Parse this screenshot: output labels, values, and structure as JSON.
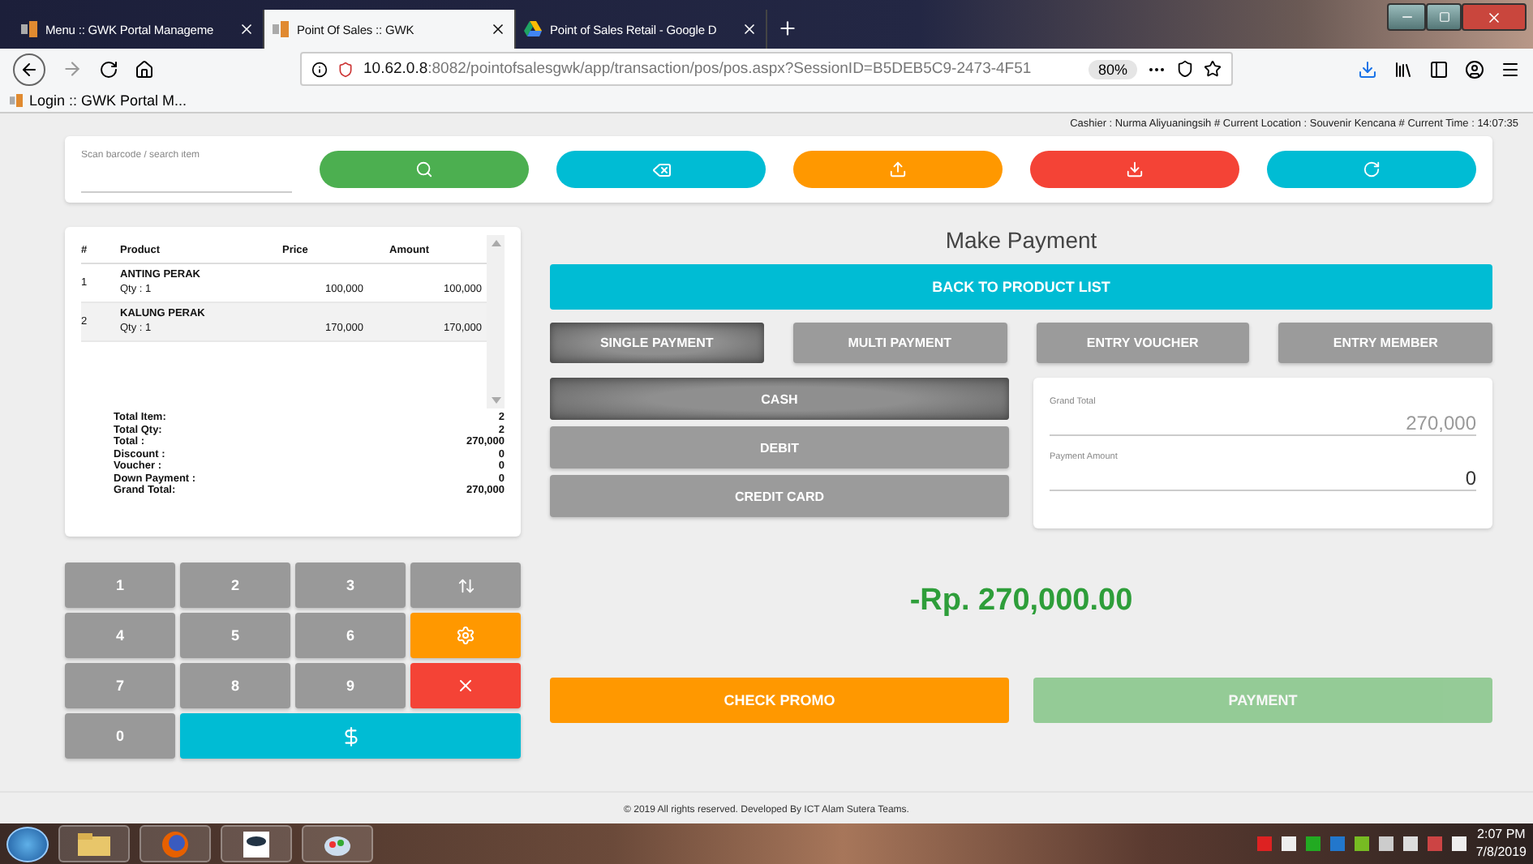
{
  "browser": {
    "tabs": [
      {
        "title": "Menu :: GWK Portal Manageme",
        "selected": false
      },
      {
        "title": "Point Of Sales :: GWK",
        "selected": true
      },
      {
        "title": "Point of Sales Retail - Google D",
        "selected": false
      }
    ],
    "url_host": "10.62.0.8",
    "url_rest": ":8082/pointofsalesgwk/app/transaction/pos/pos.aspx?SessionID=B5DEB5C9-2473-4F51",
    "zoom": "80%",
    "bookmarks": [
      "Login :: GWK Portal M..."
    ]
  },
  "status_line": "Cashier : Nurma Aliyuaningsih # Current Location : Souvenir Kencana # Current Time : 14:07:35",
  "search": {
    "placeholder": "Scan barcode / search item"
  },
  "cart": {
    "columns": [
      "#",
      "Product",
      "Price",
      "Amount"
    ],
    "items": [
      {
        "no": "1",
        "product": "ANTING PERAK",
        "qty": "Qty : 1",
        "price": "100,000",
        "amount": "100,000",
        "selected": false
      },
      {
        "no": "2",
        "product": "KALUNG PERAK",
        "qty": "Qty : 1",
        "price": "170,000",
        "amount": "170,000",
        "selected": true
      }
    ],
    "totals": [
      {
        "label": "Total Item:",
        "value": "2"
      },
      {
        "label": "Total Qty:",
        "value": "2"
      },
      {
        "label": "Total :",
        "value": "270,000"
      },
      {
        "label": "Discount :",
        "value": "0"
      },
      {
        "label": "Voucher :",
        "value": "0"
      },
      {
        "label": "Down Payment :",
        "value": "0"
      },
      {
        "label": "Grand Total:",
        "value": "270,000"
      }
    ]
  },
  "keypad": {
    "digits": [
      "1",
      "2",
      "3",
      "4",
      "5",
      "6",
      "7",
      "8",
      "9",
      "0"
    ]
  },
  "payment": {
    "title": "Make Payment",
    "back_button": "BACK TO PRODUCT LIST",
    "modes": [
      {
        "label": "SINGLE PAYMENT",
        "selected": true
      },
      {
        "label": "MULTI PAYMENT",
        "selected": false
      },
      {
        "label": "ENTRY VOUCHER",
        "selected": false
      },
      {
        "label": "ENTRY MEMBER",
        "selected": false
      }
    ],
    "methods": [
      {
        "label": "CASH",
        "selected": true
      },
      {
        "label": "DEBIT",
        "selected": false
      },
      {
        "label": "CREDIT CARD",
        "selected": false
      }
    ],
    "grand_total": {
      "label": "Grand Total",
      "value": "270,000"
    },
    "payment_amount": {
      "label": "Payment Amount",
      "value": "0"
    },
    "balance": "-Rp. 270,000.00",
    "check_promo": "CHECK PROMO",
    "payment_button": {
      "label": "PAYMENT",
      "disabled": true
    }
  },
  "footer": "© 2019 All rights reserved. Developed By ICT Alam Sutera Teams.",
  "taskbar": {
    "time": "2:07 PM",
    "date": "7/8/2019"
  }
}
